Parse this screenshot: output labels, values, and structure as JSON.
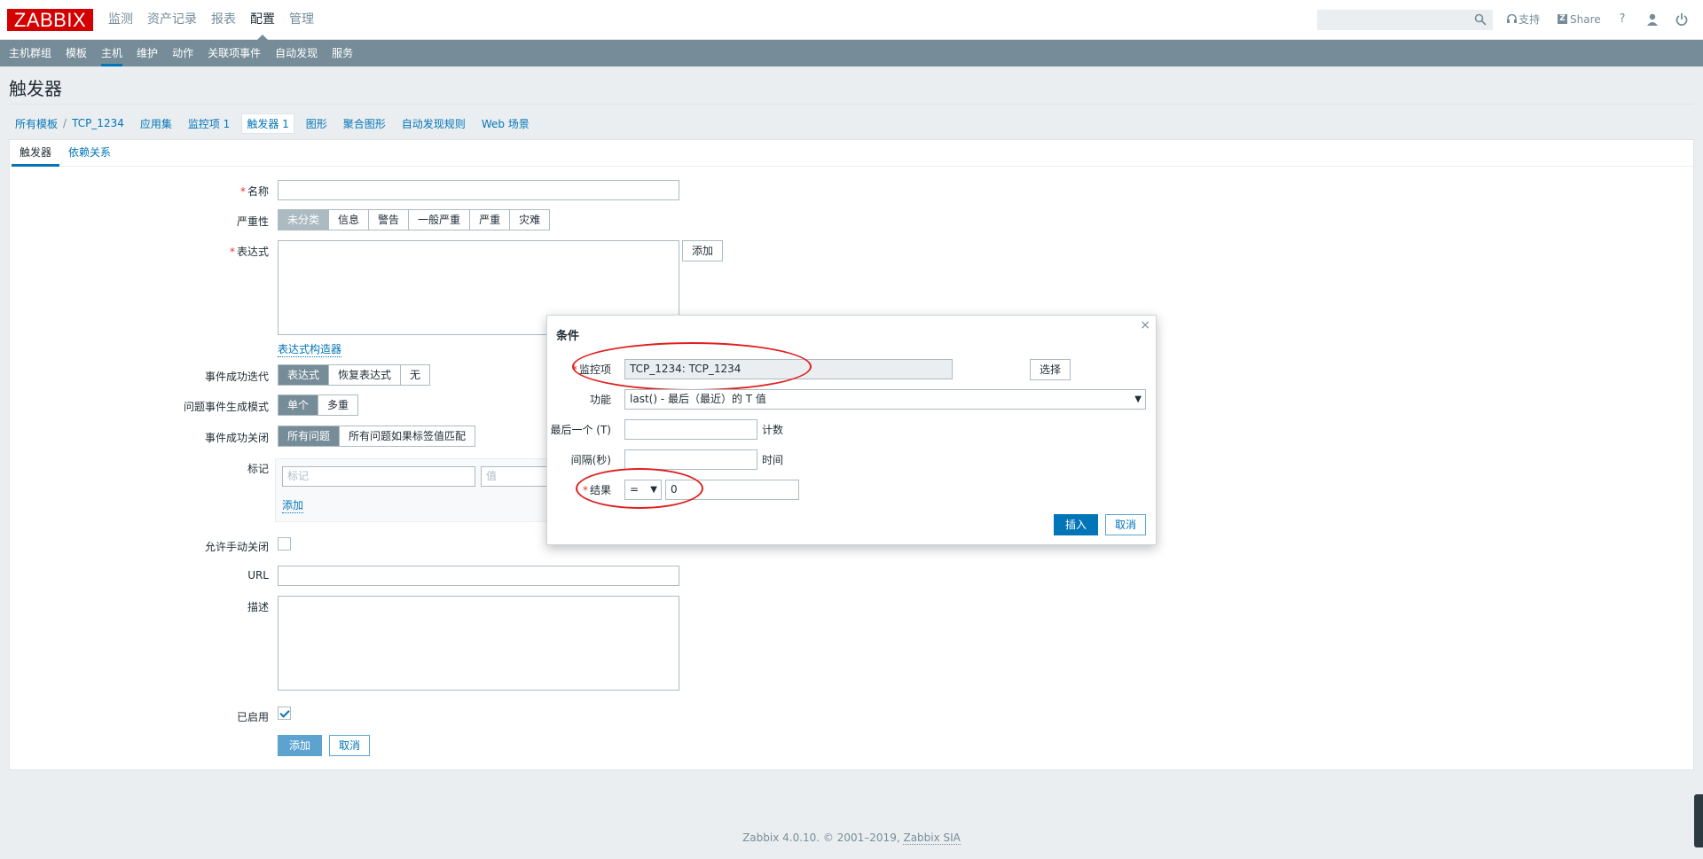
{
  "header": {
    "logo": "ZABBIX",
    "menu": [
      "监测",
      "资产记录",
      "报表",
      "配置",
      "管理"
    ],
    "selected_menu": "配置",
    "support": "支持",
    "share": "Share",
    "help": "?"
  },
  "submenu": [
    "主机群组",
    "模板",
    "主机",
    "维护",
    "动作",
    "关联项事件",
    "自动发现",
    "服务"
  ],
  "page_title": "触发器",
  "breadcrumb": {
    "all_templates": "所有模板",
    "template": "TCP_1234",
    "apps": "应用集",
    "items": "监控项 1",
    "triggers": "触发器 1",
    "graphs": "图形",
    "screens": "聚合图形",
    "discovery": "自动发现规则",
    "web": "Web 场景"
  },
  "tabs": [
    "触发器",
    "依赖关系"
  ],
  "form": {
    "name_label": "名称",
    "severity_label": "严重性",
    "severities": [
      "未分类",
      "信息",
      "警告",
      "一般严重",
      "严重",
      "灾难"
    ],
    "expression_label": "表达式",
    "add_button": "添加",
    "expression_builder": "表达式构造器",
    "ok_event_label": "事件成功迭代",
    "ok_event_options": [
      "表达式",
      "恢复表达式",
      "无"
    ],
    "problem_mode_label": "问题事件生成模式",
    "problem_mode_options": [
      "单个",
      "多重"
    ],
    "ok_close_label": "事件成功关闭",
    "ok_close_options": [
      "所有问题",
      "所有问题如果标签值匹配"
    ],
    "tags_label": "标记",
    "tag_placeholder": "标记",
    "value_placeholder": "值",
    "tags_add": "添加",
    "manual_close_label": "允许手动关闭",
    "url_label": "URL",
    "description_label": "描述",
    "enabled_label": "已启用",
    "submit": "添加",
    "cancel": "取消"
  },
  "dialog": {
    "title": "条件",
    "item_label": "监控项",
    "item_value": "TCP_1234: TCP_1234",
    "select_button": "选择",
    "function_label": "功能",
    "function_value": "last() - 最后（最近）的 T 值",
    "last_label": "最后一个 (T)",
    "count_suffix": "计数",
    "interval_label": "间隔(秒)",
    "time_suffix": "时间",
    "result_label": "结果",
    "operator": "=",
    "result_value": "0",
    "insert_button": "插入",
    "cancel_button": "取消"
  },
  "footer": {
    "text": "Zabbix 4.0.10. © 2001–2019, ",
    "company": "Zabbix SIA"
  }
}
